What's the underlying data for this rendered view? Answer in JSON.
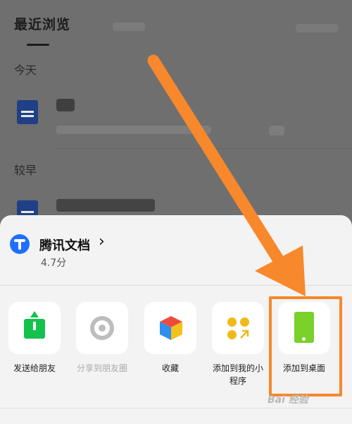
{
  "background": {
    "tab_recent": "最近浏览",
    "section_today": "今天",
    "section_earlier": "较早"
  },
  "app": {
    "title": "腾讯文档",
    "chevron": "›",
    "rating": "4.7分"
  },
  "actions": [
    {
      "label": "发送给朋友",
      "icon": "share-icon",
      "enabled": true
    },
    {
      "label": "分享到朋友圈",
      "icon": "aperture-icon",
      "enabled": false
    },
    {
      "label": "收藏",
      "icon": "cube-icon",
      "enabled": true
    },
    {
      "label": "添加到我的小程序",
      "icon": "mini-program-icon",
      "enabled": true
    },
    {
      "label": "添加到桌面",
      "icon": "phone-icon",
      "enabled": true
    }
  ],
  "annotation": {
    "arrow_color": "#f7882b",
    "highlight_color": "#f7882b"
  },
  "watermark": "Bai 经验"
}
